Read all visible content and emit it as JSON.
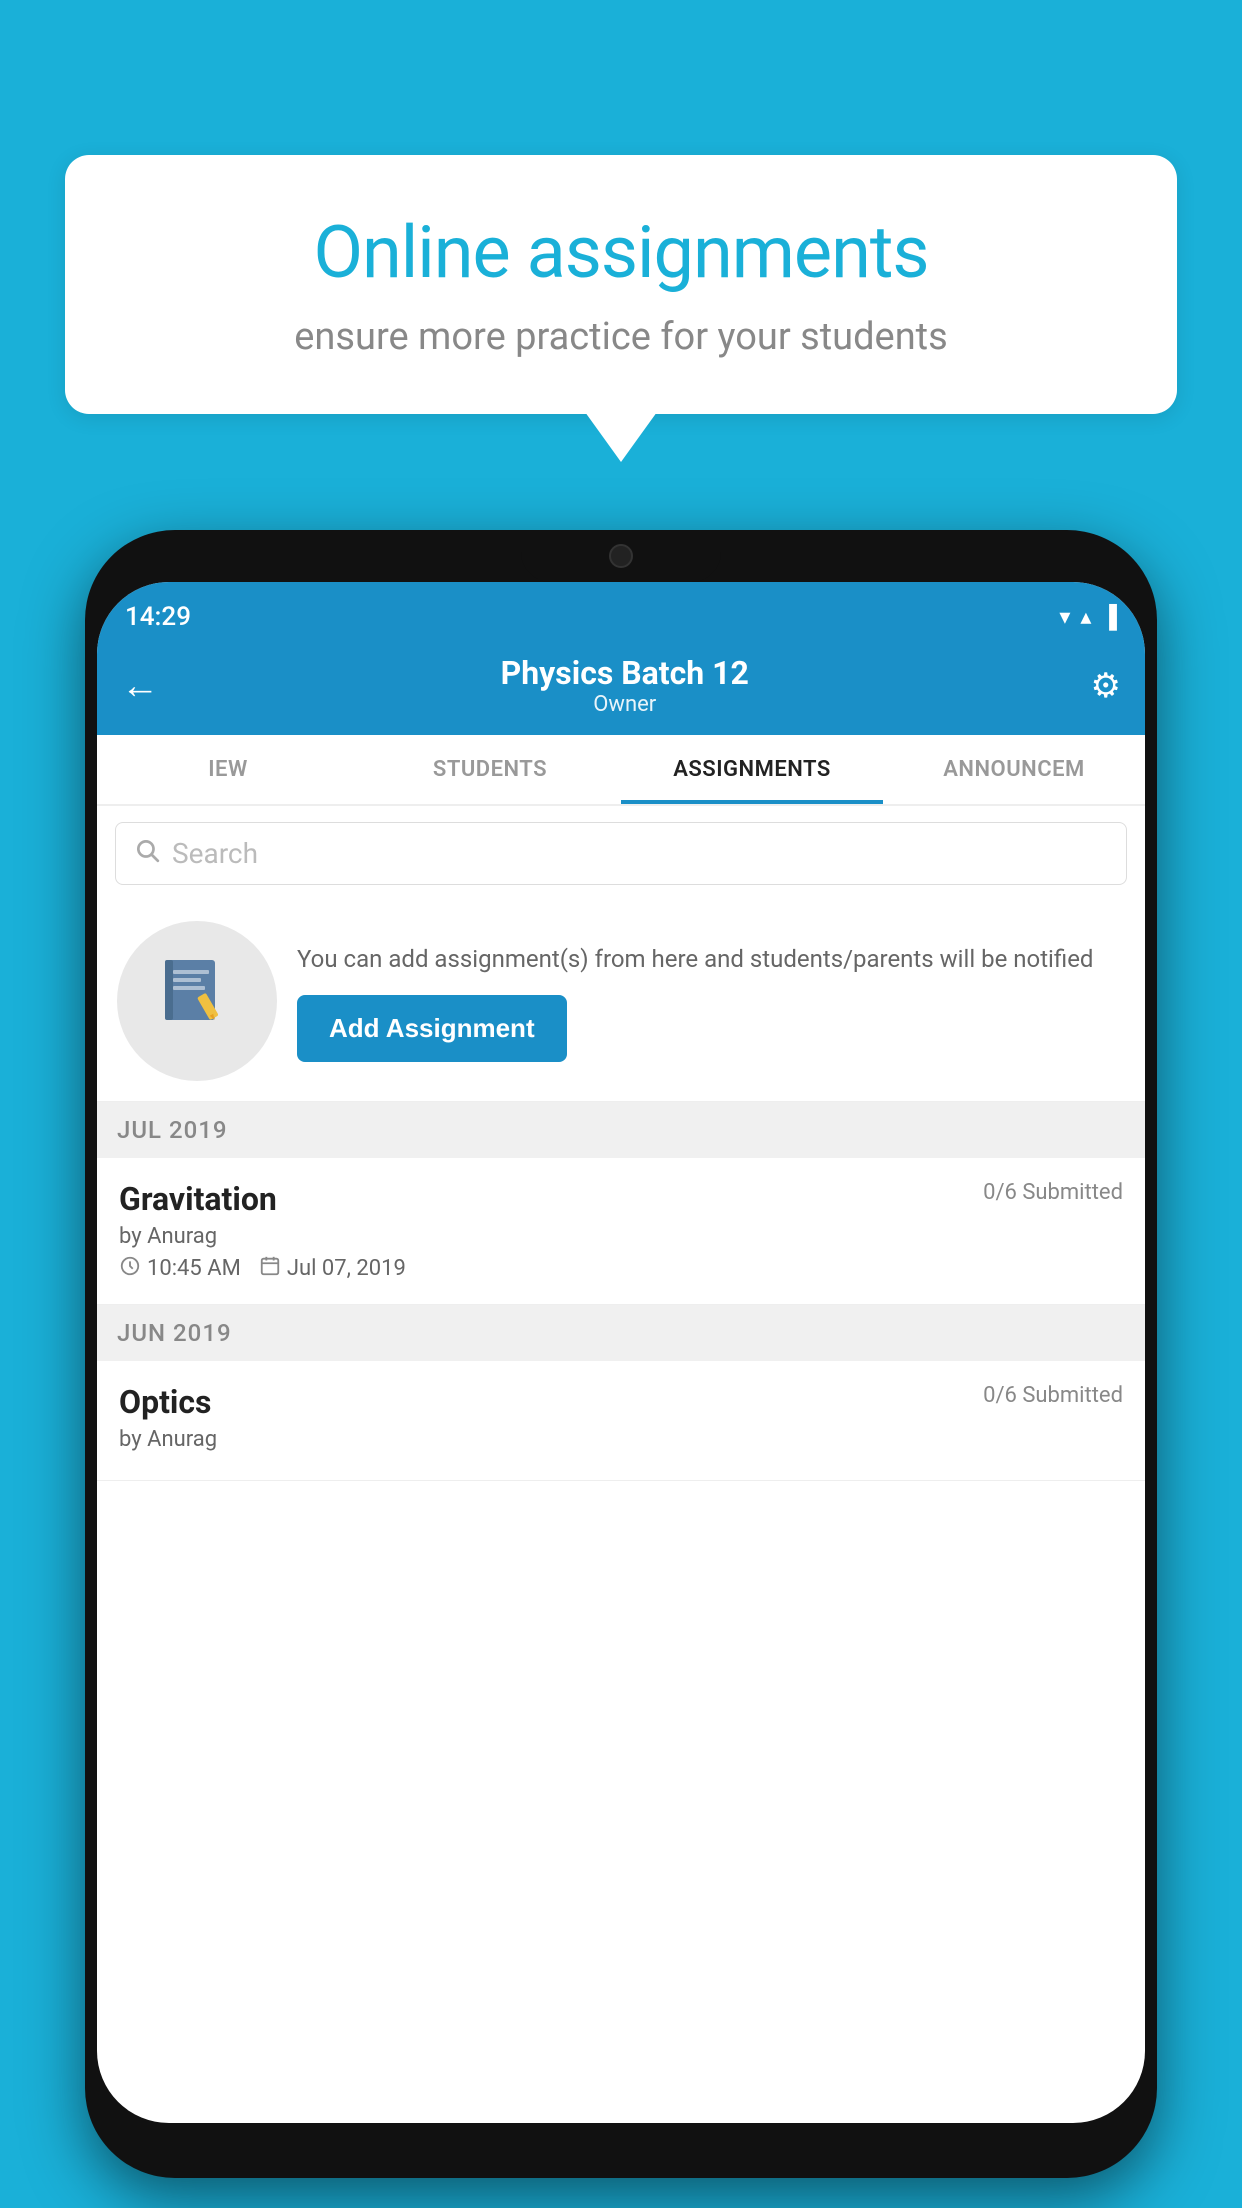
{
  "background_color": "#1ab0d8",
  "speech_bubble": {
    "title": "Online assignments",
    "subtitle": "ensure more practice for your students"
  },
  "phone": {
    "status_bar": {
      "time": "14:29",
      "icons": "▾ ▴ ▐"
    },
    "header": {
      "title": "Physics Batch 12",
      "subtitle": "Owner",
      "back_label": "←",
      "settings_label": "⚙"
    },
    "tabs": [
      {
        "label": "IEW",
        "active": false
      },
      {
        "label": "STUDENTS",
        "active": false
      },
      {
        "label": "ASSIGNMENTS",
        "active": true
      },
      {
        "label": "ANNOUNCEM",
        "active": false
      }
    ],
    "search": {
      "placeholder": "Search"
    },
    "promo": {
      "description": "You can add assignment(s) from here and students/parents will be notified",
      "button_label": "Add Assignment"
    },
    "sections": [
      {
        "label": "JUL 2019",
        "assignments": [
          {
            "title": "Gravitation",
            "submitted": "0/6 Submitted",
            "author": "by Anurag",
            "time": "10:45 AM",
            "date": "Jul 07, 2019"
          }
        ]
      },
      {
        "label": "JUN 2019",
        "assignments": [
          {
            "title": "Optics",
            "submitted": "0/6 Submitted",
            "author": "by Anurag",
            "time": "",
            "date": ""
          }
        ]
      }
    ]
  }
}
